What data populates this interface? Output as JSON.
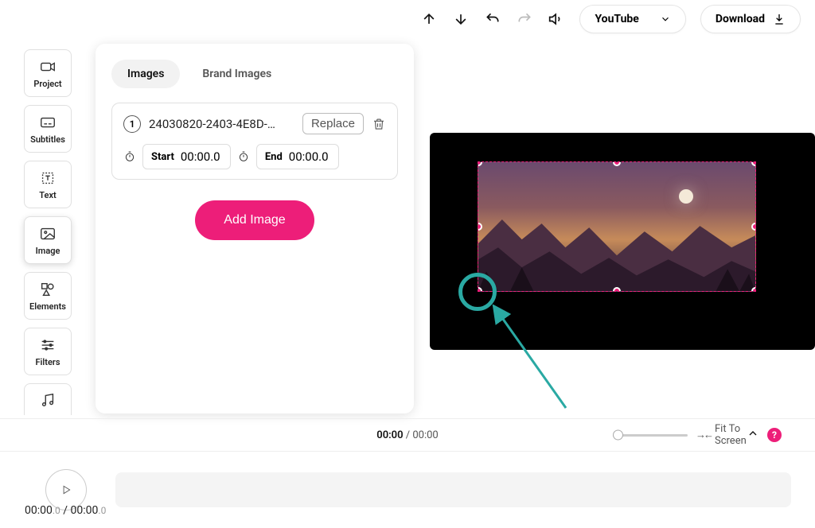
{
  "topbar": {
    "preset_label": "YouTube",
    "download_label": "Download"
  },
  "sidebar": {
    "items": [
      {
        "label": "Project"
      },
      {
        "label": "Subtitles"
      },
      {
        "label": "Text"
      },
      {
        "label": "Image"
      },
      {
        "label": "Elements"
      },
      {
        "label": "Filters"
      },
      {
        "label": ""
      }
    ]
  },
  "panel": {
    "tabs": {
      "images": "Images",
      "brand": "Brand Images"
    },
    "card": {
      "index": "1",
      "filename": "24030820-2403-4E8D-…",
      "replace": "Replace",
      "start_label": "Start",
      "start_value": "00:00.0",
      "end_label": "End",
      "end_value": "00:00.0"
    },
    "add_button": "Add Image"
  },
  "timeline": {
    "current": "00:00",
    "total": "00:00",
    "fit_label": "Fit To Screen",
    "help": "?",
    "readout_current": "00:00",
    "readout_current_dec": ".0",
    "readout_total": "00:00",
    "readout_total_dec": ".0"
  }
}
